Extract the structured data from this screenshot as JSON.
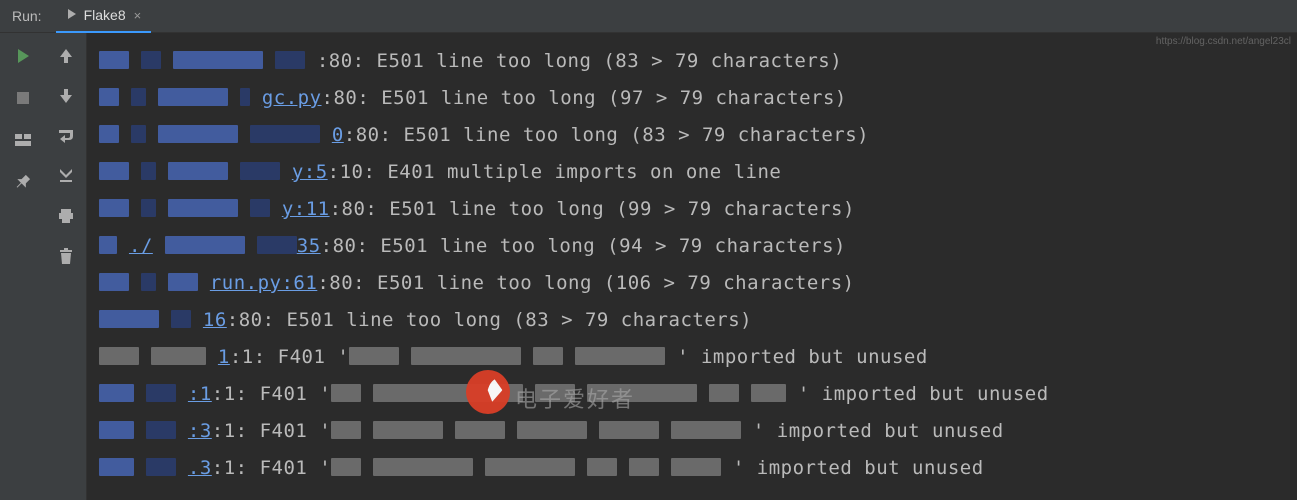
{
  "header": {
    "run_label": "Run:",
    "tab_label": "Flake8",
    "tab_close": "×"
  },
  "watermark": {
    "text": "电子爱好者",
    "url": "https://blog.csdn.net/angel23cl"
  },
  "lines": [
    {
      "redactions": [
        [
          "r-b",
          30
        ],
        [
          "r-b2",
          20
        ],
        [
          "r-b",
          90
        ],
        [
          "r-b2",
          30
        ]
      ],
      "location": "",
      "pos": ":80:",
      "msg": " E501 line too long (83 > 79 characters)"
    },
    {
      "redactions": [
        [
          "r-b",
          20
        ],
        [
          "r-b2",
          15
        ],
        [
          "r-b",
          70
        ],
        [
          "r-b2",
          10
        ]
      ],
      "location": "gc.py",
      "pos": ":80:",
      "msg": " E501 line too long (97 > 79 characters)"
    },
    {
      "redactions": [
        [
          "r-b",
          20
        ],
        [
          "r-b2",
          15
        ],
        [
          "r-b",
          80
        ],
        [
          "r-b2",
          70
        ]
      ],
      "location": "0",
      "pos": ":80:",
      "msg": " E501 line too long (83 > 79 characters)"
    },
    {
      "redactions": [
        [
          "r-b",
          30
        ],
        [
          "r-b2",
          15
        ],
        [
          "r-b",
          60
        ],
        [
          "r-b2",
          40
        ]
      ],
      "location": "y:5",
      "pos": ":10:",
      "msg": " E401 multiple imports on one line"
    },
    {
      "redactions": [
        [
          "r-b",
          30
        ],
        [
          "r-b2",
          15
        ],
        [
          "r-b",
          70
        ],
        [
          "r-b2",
          20
        ]
      ],
      "location": "y:11",
      "pos": ":80:",
      "msg": " E501 line too long (99 > 79 characters)"
    },
    {
      "redactions": [
        [
          "r-b",
          18
        ]
      ],
      "location": "./",
      "redactions2": [
        [
          "r-b",
          80
        ],
        [
          "r-b2",
          40
        ]
      ],
      "location2": "35",
      "pos": ":80:",
      "msg": " E501 line too long (94 > 79 characters)"
    },
    {
      "redactions": [
        [
          "r-b",
          30
        ],
        [
          "r-b2",
          15
        ],
        [
          "r-b",
          30
        ]
      ],
      "location": "run.py:61",
      "pos": ":80:",
      "msg": " E501 line too long (106 > 79 characters)"
    },
    {
      "redactions": [
        [
          "r-b",
          60
        ],
        [
          "r-b2",
          20
        ]
      ],
      "location": "16",
      "pos": ":80:",
      "msg": " E501 line too long (83 > 79 characters)"
    },
    {
      "redactions": [
        [
          "r-g",
          40
        ],
        [
          "r-g",
          55
        ]
      ],
      "location": "1",
      "pos": ":1:",
      "msg_pre": " F401 '",
      "mid_redactions": [
        [
          "r-g",
          50
        ],
        [
          "r-g",
          110
        ],
        [
          "r-g",
          30
        ],
        [
          "r-g",
          90
        ]
      ],
      "msg_post": "' imported but unused"
    },
    {
      "redactions": [
        [
          "r-b",
          35
        ],
        [
          "r-b2",
          30
        ]
      ],
      "location": ":1",
      "pos": ":1:",
      "msg_pre": " F401 '",
      "mid_redactions": [
        [
          "r-g",
          30
        ],
        [
          "r-g",
          150
        ],
        [
          "r-g",
          40
        ],
        [
          "r-g",
          110
        ],
        [
          "r-g",
          30
        ],
        [
          "r-g",
          35
        ]
      ],
      "msg_post": "' imported but unused"
    },
    {
      "redactions": [
        [
          "r-b",
          35
        ],
        [
          "r-b2",
          30
        ]
      ],
      "location": ":3",
      "pos": ":1:",
      "msg_pre": " F401 '",
      "mid_redactions": [
        [
          "r-g",
          30
        ],
        [
          "r-g",
          70
        ],
        [
          "r-g",
          50
        ],
        [
          "r-g",
          70
        ],
        [
          "r-g",
          60
        ],
        [
          "r-g",
          70
        ]
      ],
      "msg_post": "' imported but unused"
    },
    {
      "redactions": [
        [
          "r-b",
          35
        ],
        [
          "r-b2",
          30
        ]
      ],
      "location": ".3",
      "pos": ":1:",
      "msg_pre": " F401 '",
      "mid_redactions": [
        [
          "r-g",
          30
        ],
        [
          "r-g",
          100
        ],
        [
          "r-g",
          90
        ],
        [
          "r-g",
          30
        ],
        [
          "r-g",
          30
        ],
        [
          "r-g",
          50
        ]
      ],
      "msg_post": "' imported but unused"
    }
  ]
}
